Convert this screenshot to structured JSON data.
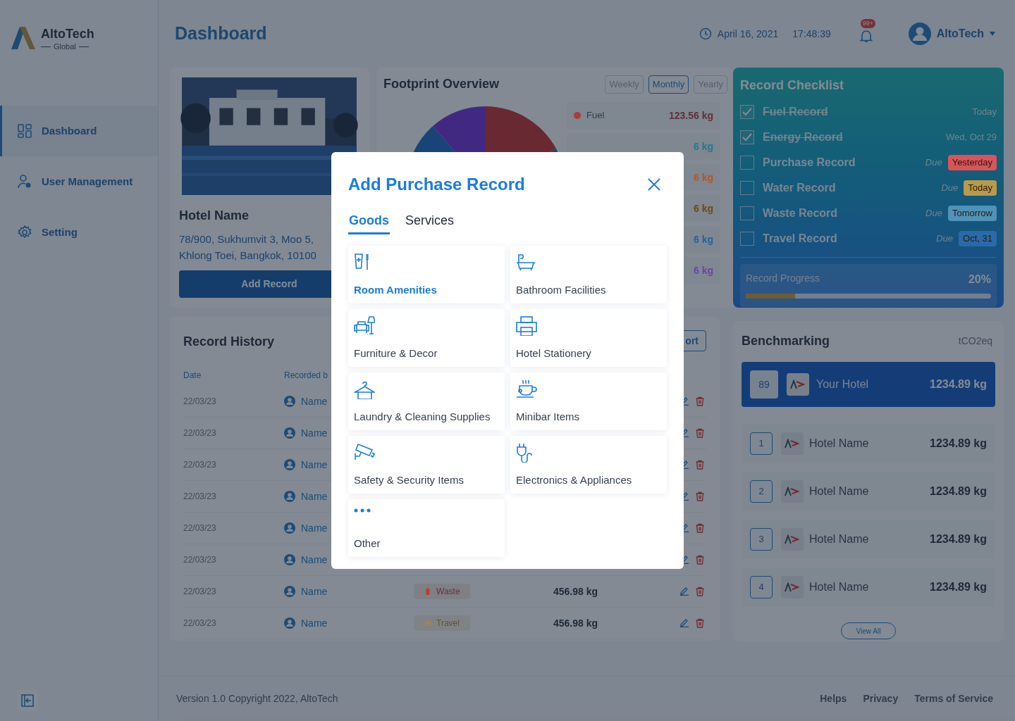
{
  "sidebar": {
    "logo": {
      "name": "AltoTech",
      "sub": "Global"
    },
    "items": [
      {
        "label": "Dashboard",
        "kind": "dashboard",
        "selected": true
      },
      {
        "label": "User Management",
        "kind": "users",
        "selected": false
      },
      {
        "label": "Setting",
        "kind": "settings",
        "selected": false
      }
    ]
  },
  "header": {
    "title": "Dashboard",
    "date": "April 16, 2021",
    "time": "17:48:39",
    "notification_badge": "99+",
    "user": "AltoTech"
  },
  "hotel_card": {
    "name": "Hotel Name",
    "address": "78/900, Sukhumvit 3, Moo 5, Khlong Toei, Bangkok, 10100",
    "button": "Add Record"
  },
  "footprint": {
    "title": "Footprint Overview",
    "periods": [
      {
        "label": "Weekly",
        "selected": false
      },
      {
        "label": "Monthly",
        "selected": true
      },
      {
        "label": "Yearly",
        "selected": false
      }
    ],
    "legend": [
      {
        "label": "Fuel",
        "value": "123.56 kg",
        "color": "#b03a3a"
      },
      {
        "value": "6 kg",
        "color": "#1f7a8c"
      },
      {
        "value": "6 kg",
        "color": "#b5542a"
      },
      {
        "value": "6 kg",
        "color": "#6e4a12"
      },
      {
        "value": "6 kg",
        "color": "#2c5f9e"
      },
      {
        "value": "6 kg",
        "color": "#6b45a8"
      }
    ]
  },
  "record_checklist": {
    "title": "Record Checklist",
    "items": [
      {
        "label": "Fuel Record",
        "checked": true,
        "due": "Today"
      },
      {
        "label": "Energy Record",
        "checked": true,
        "due": "Wed, Oct 29"
      },
      {
        "label": "Purchase Record",
        "checked": false,
        "due_label": "Due",
        "due": "Yesterday",
        "color": "#d9545a"
      },
      {
        "label": "Water Record",
        "checked": false,
        "due_label": "Due",
        "due": "Today",
        "color": "#b89a4c"
      },
      {
        "label": "Waste Record",
        "checked": false,
        "due_label": "Due",
        "due": "Tomorrow",
        "color": "#4f93b8"
      },
      {
        "label": "Travel Record",
        "checked": false,
        "due_label": "Due",
        "due": "Oct, 31",
        "color": "#2a6aa8"
      }
    ],
    "progress": {
      "label": "Record Progress",
      "reading": "20%",
      "level": 0.2
    }
  },
  "benchmarking": {
    "title": "Benchmarking",
    "unit": "tCO2eq",
    "own": {
      "rank": "89",
      "name": "Your Hotel",
      "value": "1234.89 kg"
    },
    "rows": [
      {
        "rank": "1",
        "name": "Hotel Name",
        "value": "1234.89 kg"
      },
      {
        "rank": "2",
        "name": "Hotel Name",
        "value": "1234.89 kg"
      },
      {
        "rank": "3",
        "name": "Hotel Name",
        "value": "1234.89 kg"
      },
      {
        "rank": "4",
        "name": "Hotel Name",
        "value": "1234.89 kg"
      }
    ],
    "view_all": "View All"
  },
  "record_history": {
    "title": "Record History",
    "export_button": "ort",
    "columns": [
      "Date",
      "Recorded b"
    ],
    "rows": [
      {
        "date": "22/03/23",
        "recorded_by": "Name"
      },
      {
        "date": "22/03/23",
        "recorded_by": "Name"
      },
      {
        "date": "22/03/23",
        "recorded_by": "Name"
      },
      {
        "date": "22/03/23",
        "recorded_by": "Name"
      },
      {
        "date": "22/03/23",
        "recorded_by": "Name"
      },
      {
        "date": "22/03/23",
        "recorded_by": "Name"
      },
      {
        "date": "22/03/23",
        "recorded_by": "Name",
        "type": "Waste",
        "kind": "waste",
        "color": "#b3442e",
        "amount": "456.98 kg"
      },
      {
        "date": "22/03/23",
        "recorded_by": "Name",
        "type": "Travel",
        "kind": "travel",
        "color": "#b5862d",
        "amount": "456.98 kg"
      }
    ]
  },
  "modal": {
    "title": "Add Purchase Record",
    "tabs": [
      {
        "label": "Goods",
        "selected": true
      },
      {
        "label": "Services",
        "selected": false
      }
    ],
    "categories": [
      {
        "label": "Room Amenities",
        "kind": "amenities",
        "selected": true
      },
      {
        "label": "Bathroom Facilities",
        "kind": "bathtub",
        "selected": false
      },
      {
        "label": "Furniture & Decor",
        "kind": "furniture",
        "selected": false
      },
      {
        "label": "Hotel Stationery",
        "kind": "printer",
        "selected": false
      },
      {
        "label": "Laundry & Cleaning Supplies",
        "kind": "hanger",
        "selected": false
      },
      {
        "label": "Minibar Items",
        "kind": "cup",
        "selected": false
      },
      {
        "label": "Safety & Security Items",
        "kind": "camera",
        "selected": false
      },
      {
        "label": "Electronics & Appliances",
        "kind": "plug",
        "selected": false
      },
      {
        "label": "Other",
        "kind": "more",
        "selected": false
      }
    ]
  },
  "footer": {
    "copyright": "Version 1.0 Copyright 2022, AltoTech",
    "links": [
      "Helps",
      "Privacy",
      "Terms of Service"
    ]
  }
}
